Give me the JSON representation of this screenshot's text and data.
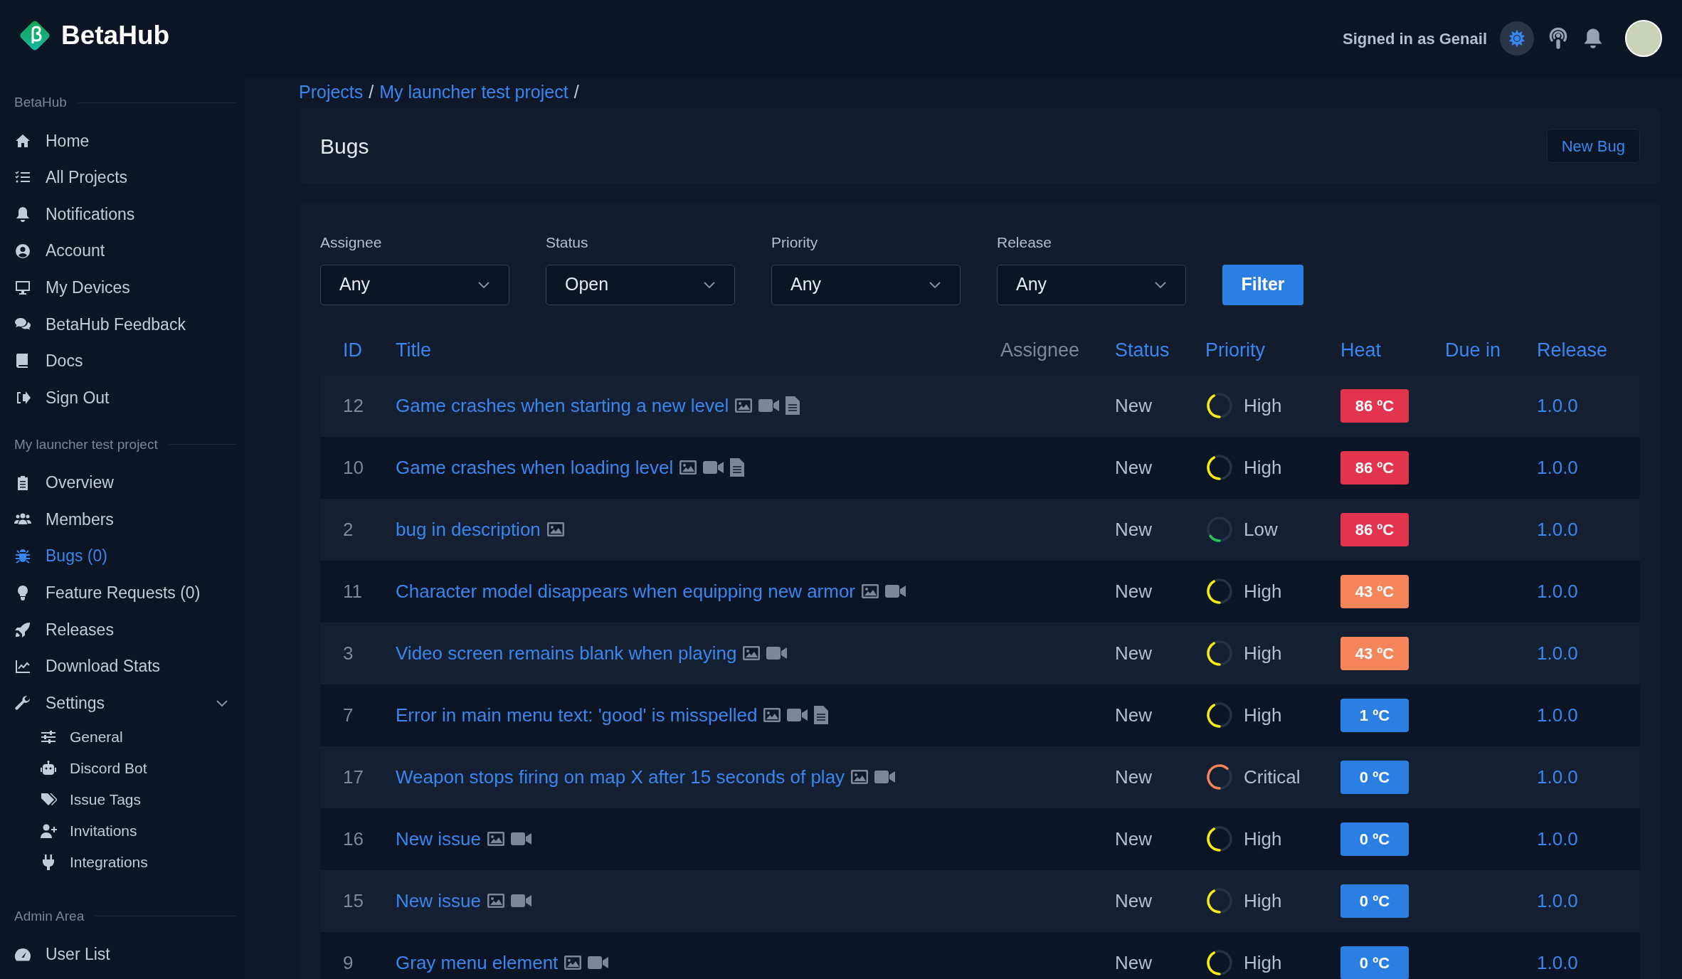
{
  "app": {
    "name": "BetaHub"
  },
  "header": {
    "signed_in": "Signed in as Genail"
  },
  "sidebar": {
    "sections": [
      {
        "title": "BetaHub",
        "items": [
          {
            "label": "Home",
            "selected": false
          },
          {
            "label": "All Projects",
            "selected": false
          },
          {
            "label": "Notifications",
            "selected": false
          },
          {
            "label": "Account",
            "selected": false
          },
          {
            "label": "My Devices",
            "selected": false
          },
          {
            "label": "BetaHub Feedback",
            "selected": false
          },
          {
            "label": "Docs",
            "selected": false
          },
          {
            "label": "Sign Out",
            "selected": false
          }
        ]
      },
      {
        "title": "My launcher test project",
        "items": [
          {
            "label": "Overview",
            "selected": false
          },
          {
            "label": "Members",
            "selected": false
          },
          {
            "label": "Bugs (0)",
            "selected": true
          },
          {
            "label": "Feature Requests (0)",
            "selected": false
          },
          {
            "label": "Releases",
            "selected": false
          },
          {
            "label": "Download Stats",
            "selected": false
          },
          {
            "label": "Settings",
            "selected": false,
            "expanded": true,
            "children": [
              {
                "label": "General",
                "selected": false
              },
              {
                "label": "Discord Bot",
                "selected": false
              },
              {
                "label": "Issue Tags",
                "selected": false
              },
              {
                "label": "Invitations",
                "selected": false
              },
              {
                "label": "Integrations",
                "selected": false
              }
            ]
          }
        ]
      },
      {
        "title": "Admin Area",
        "items": [
          {
            "label": "User List",
            "selected": false
          }
        ]
      }
    ]
  },
  "breadcrumb": [
    "Projects",
    "My launcher test project"
  ],
  "breadcrumb_separator": "/",
  "page": {
    "title": "Bugs",
    "new_button": "New Bug"
  },
  "filters": [
    {
      "label": "Assignee",
      "value": "Any"
    },
    {
      "label": "Status",
      "value": "Open"
    },
    {
      "label": "Priority",
      "value": "Any"
    },
    {
      "label": "Release",
      "value": "Any"
    }
  ],
  "filter_button": "Filter",
  "table": {
    "columns": [
      {
        "label": "ID",
        "sortable": true
      },
      {
        "label": "Title",
        "sortable": true
      },
      {
        "label": "Assignee",
        "sortable": false
      },
      {
        "label": "Status",
        "sortable": true
      },
      {
        "label": "Priority",
        "sortable": true
      },
      {
        "label": "Heat",
        "sortable": true
      },
      {
        "label": "Due in",
        "sortable": true
      },
      {
        "label": "Release",
        "sortable": true
      }
    ],
    "rows": [
      {
        "id": "12",
        "title": "Game crashes when starting a new level",
        "has_image": true,
        "has_video": true,
        "has_document": true,
        "status": "New",
        "priority": {
          "label": "High",
          "kind": "high",
          "color": "#f5ea14"
        },
        "heat": {
          "label": "86 ºC",
          "color": "#e3344f"
        },
        "release": "1.0.0"
      },
      {
        "id": "10",
        "title": "Game crashes when loading level",
        "has_image": true,
        "has_video": true,
        "has_document": true,
        "status": "New",
        "priority": {
          "label": "High",
          "kind": "high",
          "color": "#f5ea14"
        },
        "heat": {
          "label": "86 ºC",
          "color": "#e3344f"
        },
        "release": "1.0.0"
      },
      {
        "id": "2",
        "title": "bug in description",
        "has_image": true,
        "has_video": false,
        "has_document": false,
        "status": "New",
        "priority": {
          "label": "Low",
          "kind": "low",
          "color": "#22c55e"
        },
        "heat": {
          "label": "86 ºC",
          "color": "#e3344f"
        },
        "release": "1.0.0"
      },
      {
        "id": "11",
        "title": "Character model disappears when equipping new armor",
        "has_image": true,
        "has_video": true,
        "has_document": false,
        "status": "New",
        "priority": {
          "label": "High",
          "kind": "high",
          "color": "#f5ea14"
        },
        "heat": {
          "label": "43 ºC",
          "color": "#f4845a"
        },
        "release": "1.0.0"
      },
      {
        "id": "3",
        "title": "Video screen remains blank when playing",
        "has_image": true,
        "has_video": true,
        "has_document": false,
        "status": "New",
        "priority": {
          "label": "High",
          "kind": "high",
          "color": "#f5ea14"
        },
        "heat": {
          "label": "43 ºC",
          "color": "#f4845a"
        },
        "release": "1.0.0"
      },
      {
        "id": "7",
        "title": "Error in main menu text: 'good' is misspelled",
        "has_image": true,
        "has_video": true,
        "has_document": true,
        "status": "New",
        "priority": {
          "label": "High",
          "kind": "high",
          "color": "#f5ea14"
        },
        "heat": {
          "label": "1 ºC",
          "color": "#2b7fe3"
        },
        "release": "1.0.0"
      },
      {
        "id": "17",
        "title": "Weapon stops firing on map X after 15 seconds of play",
        "has_image": true,
        "has_video": true,
        "has_document": false,
        "status": "New",
        "priority": {
          "label": "Critical",
          "kind": "critical",
          "color": "#f4845a"
        },
        "heat": {
          "label": "0 ºC",
          "color": "#2b7fe3"
        },
        "release": "1.0.0"
      },
      {
        "id": "16",
        "title": "New issue",
        "has_image": true,
        "has_video": true,
        "has_document": false,
        "status": "New",
        "priority": {
          "label": "High",
          "kind": "high",
          "color": "#f5ea14"
        },
        "heat": {
          "label": "0 ºC",
          "color": "#2b7fe3"
        },
        "release": "1.0.0"
      },
      {
        "id": "15",
        "title": "New issue",
        "has_image": true,
        "has_video": true,
        "has_document": false,
        "status": "New",
        "priority": {
          "label": "High",
          "kind": "high",
          "color": "#f5ea14"
        },
        "heat": {
          "label": "0 ºC",
          "color": "#2b7fe3"
        },
        "release": "1.0.0"
      },
      {
        "id": "9",
        "title": "Gray menu element",
        "has_image": true,
        "has_video": true,
        "has_document": false,
        "status": "New",
        "priority": {
          "label": "High",
          "kind": "high",
          "color": "#f5ea14"
        },
        "heat": {
          "label": "0 ºC",
          "color": "#2b7fe3"
        },
        "release": "1.0.0"
      }
    ]
  }
}
